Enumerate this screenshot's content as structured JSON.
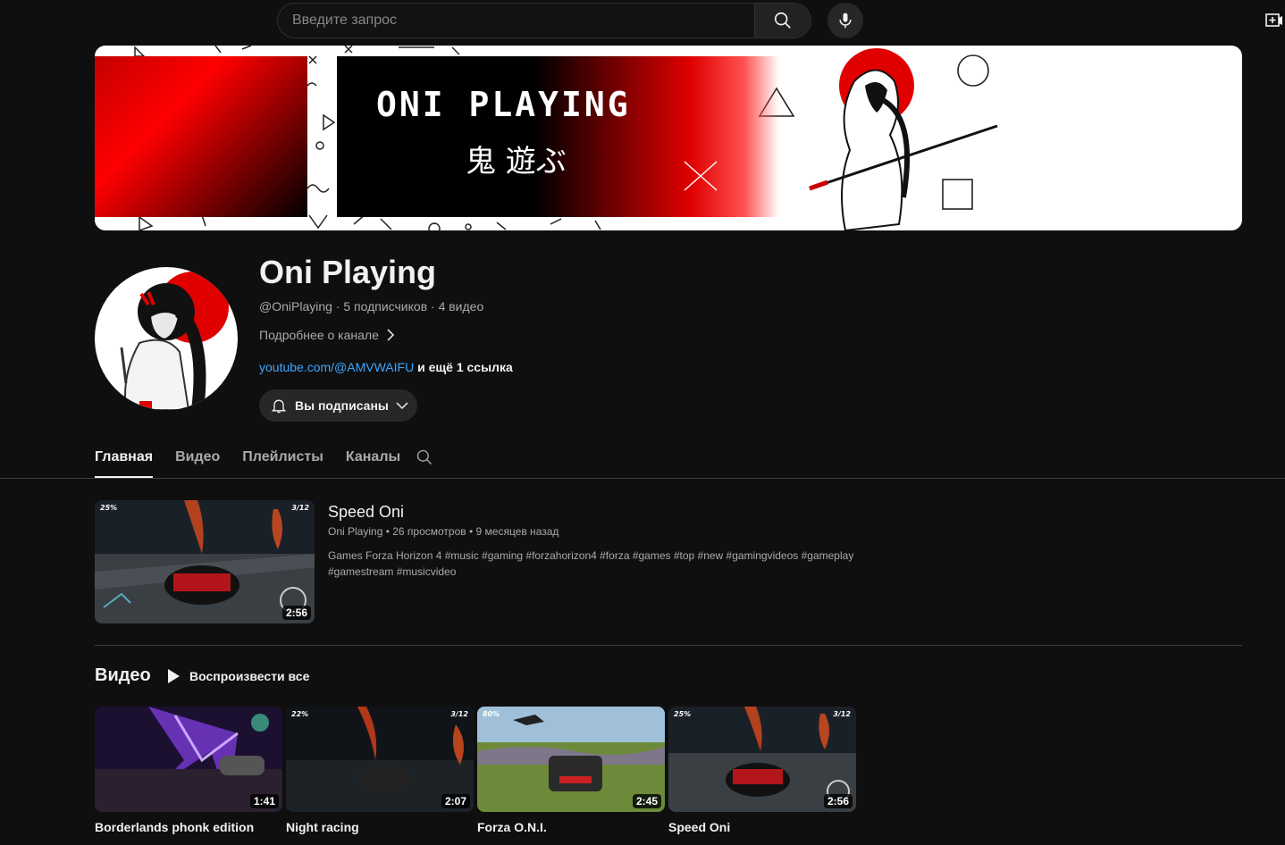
{
  "header": {
    "search_placeholder": "Введите запрос"
  },
  "banner": {
    "title": "ONI PLAYING",
    "kanji": "鬼 遊ぶ"
  },
  "channel": {
    "name": "Oni Playing",
    "meta": "@OniPlaying · 5 подписчиков · 4 видео",
    "about_label": "Подробнее о канале",
    "link_text": "youtube.com/@AMVWAIFU",
    "more_links": " и ещё 1 ссылка",
    "subscribe_label": "Вы подписаны"
  },
  "tabs": [
    {
      "label": "Главная",
      "active": true
    },
    {
      "label": "Видео",
      "active": false
    },
    {
      "label": "Плейлисты",
      "active": false
    },
    {
      "label": "Каналы",
      "active": false
    }
  ],
  "featured": {
    "title": "Speed Oni",
    "meta": "Oni Playing • 26 просмотров • 9 месяцев назад",
    "description": "Games Forza Horizon 4 #music #gaming #forzahorizon4 #forza #games #top #new #gamingvideos #gameplay #gamestream #musicvideo",
    "duration": "2:56",
    "hud_progress": "25%",
    "hud_position": "3/12"
  },
  "videos_section": {
    "title": "Видео",
    "play_all_label": "Воспроизвести все",
    "items": [
      {
        "title": "Borderlands phonk edition",
        "duration": "1:41",
        "hud_progress": "",
        "hud_position": ""
      },
      {
        "title": "Night racing",
        "duration": "2:07",
        "hud_progress": "22%",
        "hud_position": "3/12"
      },
      {
        "title": "Forza O.N.I.",
        "duration": "2:45",
        "hud_progress": "80%",
        "hud_position": ""
      },
      {
        "title": "Speed Oni",
        "duration": "2:56",
        "hud_progress": "25%",
        "hud_position": "3/12"
      }
    ]
  }
}
